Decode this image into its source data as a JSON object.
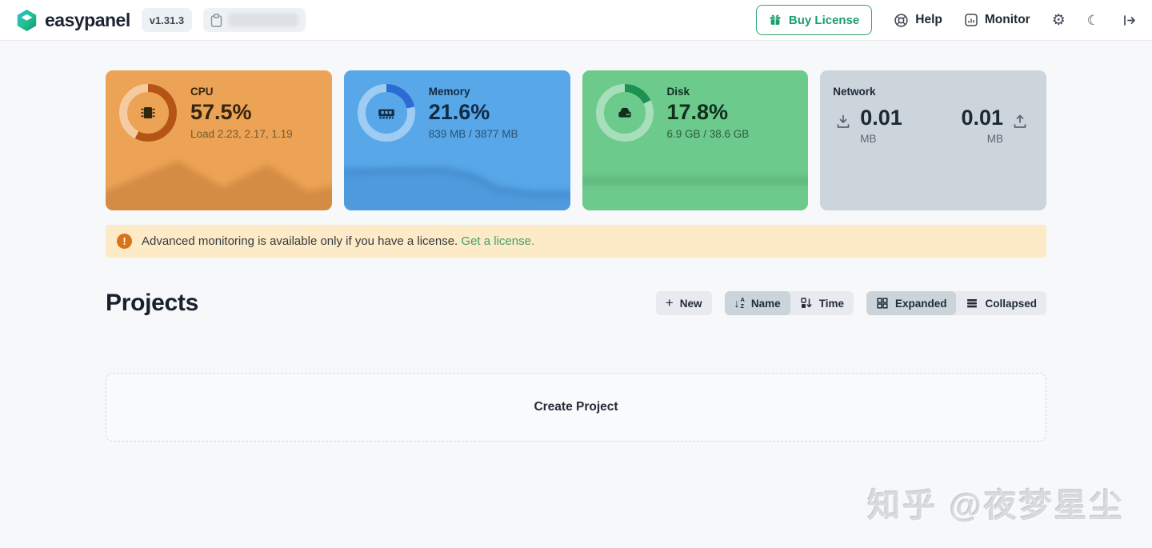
{
  "header": {
    "brand": "easypanel",
    "version_badge": "v1.31.3",
    "buy_license_label": "Buy License",
    "help_label": "Help",
    "monitor_label": "Monitor"
  },
  "cards": [
    {
      "label": "CPU",
      "value": "57.5%",
      "sub": "Load 2.23, 2.17, 1.19",
      "percent": 57.5,
      "colors": {
        "bg": "#eda355",
        "arc": "#b45515",
        "track": "rgba(255,255,255,0.45)",
        "ink": "#33260f",
        "sub": "#73592e"
      }
    },
    {
      "label": "Memory",
      "value": "21.6%",
      "sub": "839 MB / 3877 MB",
      "percent": 21.6,
      "colors": {
        "bg": "#58a7e8",
        "arc": "#2b6cd4",
        "track": "rgba(255,255,255,0.42)",
        "ink": "#112b45",
        "sub": "#2b5172"
      }
    },
    {
      "label": "Disk",
      "value": "17.8%",
      "sub": "6.9 GB / 38.6 GB",
      "percent": 17.8,
      "colors": {
        "bg": "#6cca8c",
        "arc": "#1d9152",
        "track": "rgba(255,255,255,0.40)",
        "ink": "#102e1c",
        "sub": "#2d5a3e"
      }
    },
    {
      "label": "Network",
      "down": {
        "value": "0.01",
        "unit": "MB"
      },
      "up": {
        "value": "0.01",
        "unit": "MB"
      },
      "colors": {
        "bg": "#ccd4dc",
        "arc": "none",
        "track": "none",
        "ink": "#1d2835",
        "sub": "#5c6672"
      }
    }
  ],
  "banner": {
    "text": "Advanced monitoring is available only if you have a license.",
    "link_label": "Get a license.",
    "bg": "#fdeac6",
    "link_color": "#3ba273"
  },
  "projects": {
    "title": "Projects",
    "new_label": "New",
    "sort": {
      "name_label": "Name",
      "time_label": "Time",
      "selected": "Name"
    },
    "view": {
      "expanded_label": "Expanded",
      "collapsed_label": "Collapsed",
      "selected": "Expanded"
    },
    "create_label": "Create Project"
  },
  "watermark": "知乎 @夜梦星尘"
}
